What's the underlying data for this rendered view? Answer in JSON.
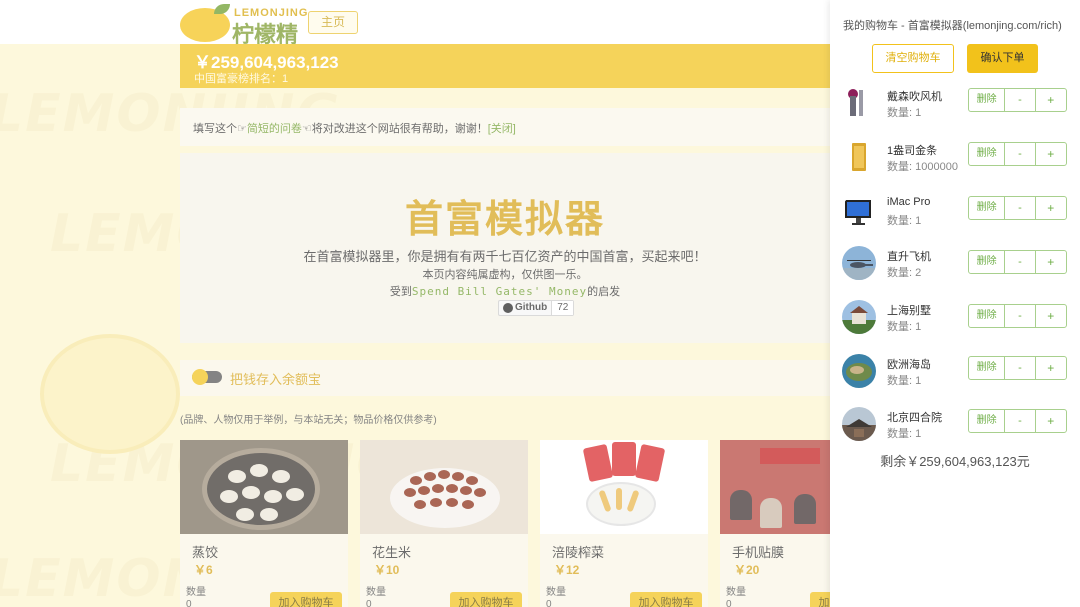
{
  "header": {
    "logo_sub": "LEMONJING",
    "logo_main": "柠檬精",
    "home_label": "主页"
  },
  "money_bar": {
    "money": "￥259,604,963,123",
    "rank": "中国富豪榜排名：1"
  },
  "survey": {
    "prefix": "填写这个",
    "link": "简短的问卷",
    "suffix": "将对改进这个网站很有帮助，谢谢！",
    "close": "[关闭]"
  },
  "hero": {
    "title": "首富模拟器",
    "description": "在首富模拟器里，你是拥有有两千七百亿资产的中国首富，买起来吧！",
    "note": "本页内容纯属虚构，仅供图一乐。",
    "inspire_prefix": "受到",
    "inspire_link": "Spend Bill Gates' Money",
    "inspire_suffix": "的启发",
    "github_label": "Github",
    "github_stars": "72"
  },
  "watermark": "LEMONJING",
  "toggle": {
    "label": "把钱存入余额宝"
  },
  "disclaimer": "(品牌、人物仅用于举例，与本站无关；物品价格仅供参考)",
  "products": [
    {
      "name": "蒸饺",
      "price": "￥6",
      "qty_label": "数量",
      "qty": "0",
      "add_label": "加入购物车"
    },
    {
      "name": "花生米",
      "price": "￥10",
      "qty_label": "数量",
      "qty": "0",
      "add_label": "加入购物车"
    },
    {
      "name": "涪陵榨菜",
      "price": "￥12",
      "qty_label": "数量",
      "qty": "0",
      "add_label": "加入购物车"
    },
    {
      "name": "手机贴膜",
      "price": "￥20",
      "qty_label": "数量",
      "qty": "0",
      "add_label": "加入购物车"
    }
  ],
  "cart": {
    "title": "我的购物车 - 首富模拟器(lemonjing.com/rich)",
    "clear_label": "清空购物车",
    "confirm_label": "确认下单",
    "delete_label": "删除",
    "minus_label": "-",
    "plus_label": "+",
    "items": [
      {
        "name": "戴森吹风机",
        "qty": "数量: 1"
      },
      {
        "name": "1盎司金条",
        "qty": "数量: 1000000"
      },
      {
        "name": "iMac Pro",
        "qty": "数量: 1"
      },
      {
        "name": "直升飞机",
        "qty": "数量: 2"
      },
      {
        "name": "上海别墅",
        "qty": "数量: 1"
      },
      {
        "name": "欧洲海岛",
        "qty": "数量: 1"
      },
      {
        "name": "北京四合院",
        "qty": "数量: 1"
      }
    ],
    "balance": "剩余￥259,604,963,123元"
  },
  "colors": {
    "brand_yellow": "#f2c21b",
    "brand_green": "#6fae47",
    "hero_title": "#d6a41a"
  }
}
